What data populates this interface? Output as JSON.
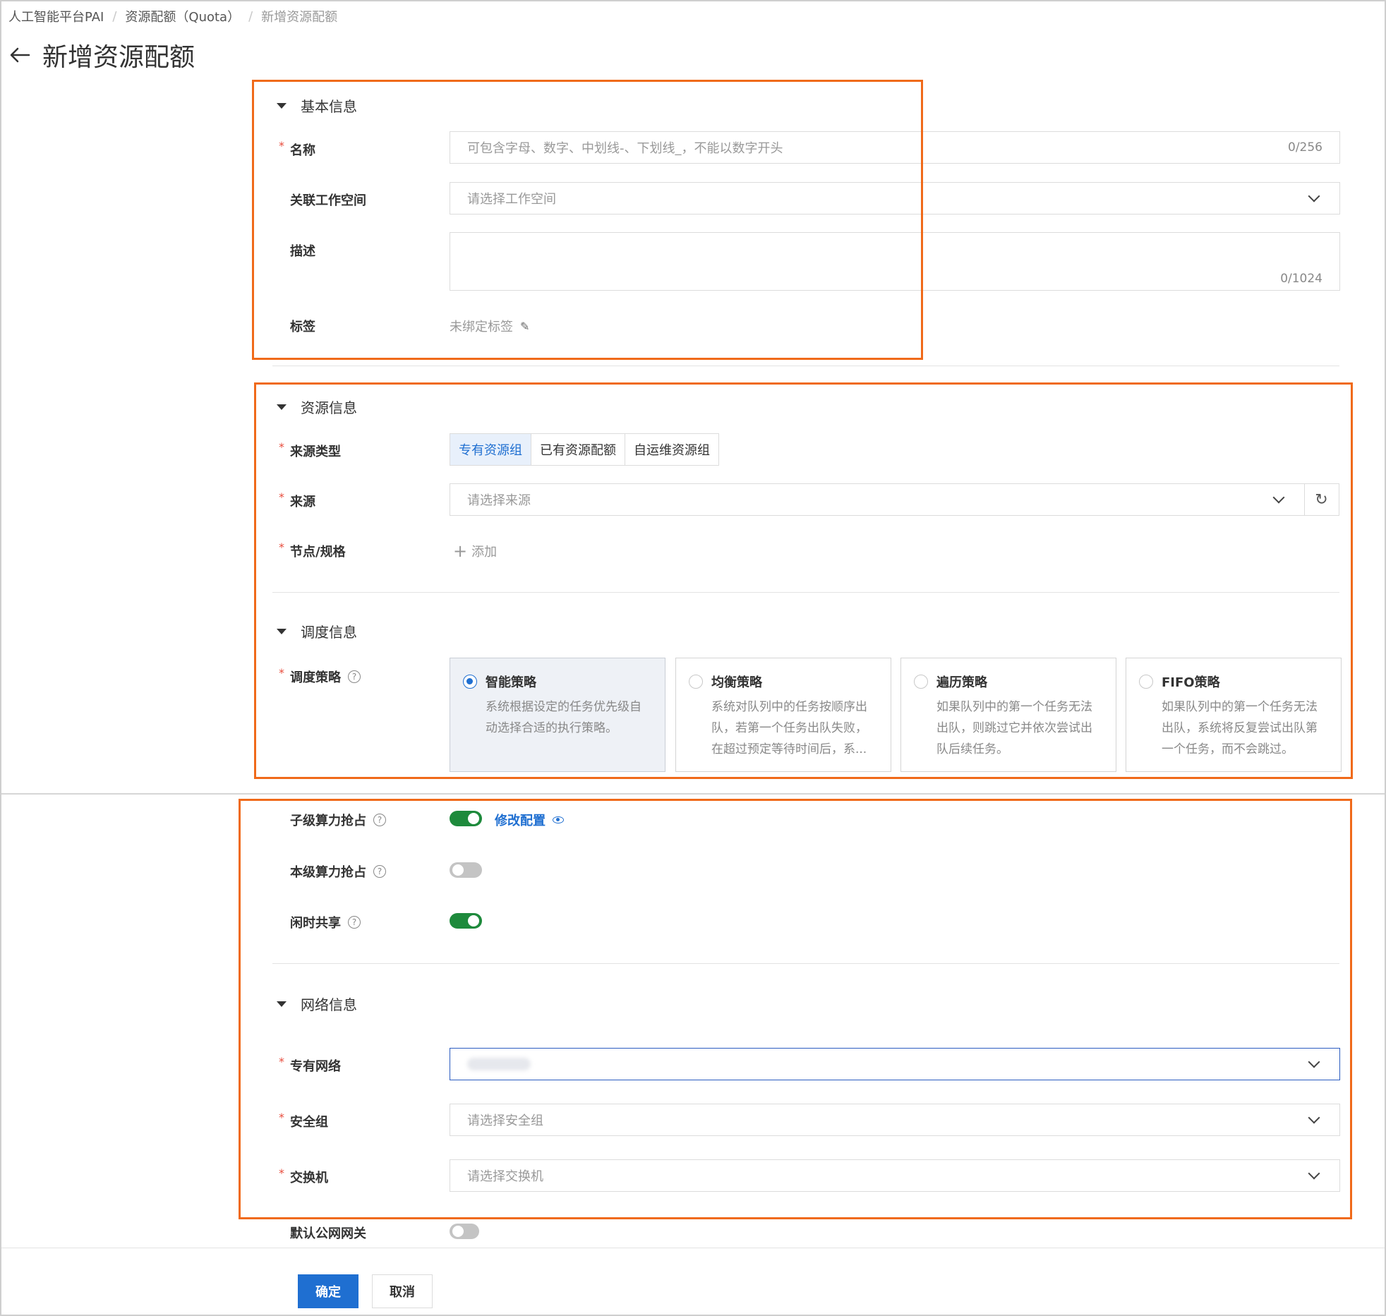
{
  "breadcrumb": {
    "items": [
      "人工智能平台PAI",
      "资源配额（Quota）",
      "新增资源配额"
    ]
  },
  "header": {
    "title": "新增资源配额"
  },
  "basic": {
    "section_title": "基本信息",
    "name_label": "名称",
    "name_placeholder": "可包含字母、数字、中划线-、下划线_，不能以数字开头",
    "name_counter": "0/256",
    "workspace_label": "关联工作空间",
    "workspace_placeholder": "请选择工作空间",
    "desc_label": "描述",
    "desc_counter": "0/1024",
    "tag_label": "标签",
    "tag_text": "未绑定标签"
  },
  "resource": {
    "section_title": "资源信息",
    "source_type_label": "来源类型",
    "source_types": [
      "专有资源组",
      "已有资源配额",
      "自运维资源组"
    ],
    "source_label": "来源",
    "source_placeholder": "请选择来源",
    "node_label": "节点/规格",
    "add_text": "添加"
  },
  "schedule": {
    "section_title": "调度信息",
    "strategy_label": "调度策略",
    "cards": [
      {
        "title": "智能策略",
        "desc": "系统根据设定的任务优先级自动选择合适的执行策略。",
        "selected": true
      },
      {
        "title": "均衡策略",
        "desc": "系统对队列中的任务按顺序出队，若第一个任务出队失败，在超过预定等待时间后，系...",
        "selected": false
      },
      {
        "title": "遍历策略",
        "desc": "如果队列中的第一个任务无法出队，则跳过它并依次尝试出队后续任务。",
        "selected": false
      },
      {
        "title": "FIFO策略",
        "desc": "如果队列中的第一个任务无法出队，系统将反复尝试出队第一个任务，而不会跳过。",
        "selected": false
      }
    ],
    "child_preempt_label": "子级算力抢占",
    "child_preempt_on": true,
    "modify_link": "修改配置",
    "self_preempt_label": "本级算力抢占",
    "self_preempt_on": false,
    "idle_share_label": "闲时共享",
    "idle_share_on": true
  },
  "network": {
    "section_title": "网络信息",
    "vpc_label": "专有网络",
    "sg_label": "安全组",
    "sg_placeholder": "请选择安全组",
    "switch_label": "交换机",
    "switch_placeholder": "请选择交换机",
    "gateway_label": "默认公网网关",
    "gateway_on": false
  },
  "actions": {
    "confirm": "确定",
    "cancel": "取消"
  },
  "colors": {
    "primary": "#1f6fd1",
    "toggle_on": "#1e8a3c",
    "annotation": "#f06a1a",
    "required": "#e84c3d"
  }
}
